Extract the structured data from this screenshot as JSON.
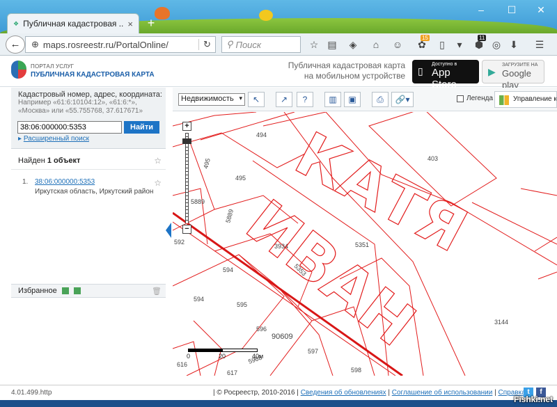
{
  "browser": {
    "tab_title": "Публичная кадастровая ...",
    "tab_close": "×",
    "new_tab": "+",
    "url": "maps.rosreestr.ru/PortalOnline/",
    "search_placeholder": "Поиск",
    "min": "–",
    "max": "☐",
    "close": "✕",
    "badge_15": "15",
    "badge_11": "11"
  },
  "portal": {
    "subtitle": "ПОРТАЛ УСЛУГ",
    "title": "ПУБЛИЧНАЯ КАДАСТРОВАЯ КАРТА",
    "mobile_line1": "Публичная кадастровая карта",
    "mobile_line2": "на мобильном устройстве",
    "appstore_small": "Доступно в",
    "appstore_big": "App Store",
    "google_small": "ЗАГРУЗИТЕ НА",
    "google_big": "Google play"
  },
  "search": {
    "hint_title": "Кадастровый номер, адрес, координата:",
    "hint_line1": "Например «61:6:10104:12», «61:6:*»,",
    "hint_line2": "«Москва» или «55.755768, 37.617671»",
    "value": "38:06:000000:5353",
    "button": "Найти",
    "advanced": "Расширенный поиск"
  },
  "results": {
    "found_prefix": "Найден ",
    "found_count": "1 объект",
    "items": [
      {
        "num": "1.",
        "id": "38:06:000000:5353",
        "address": "Иркутская область, Иркутский район"
      }
    ]
  },
  "favorites": {
    "label": "Избранное"
  },
  "toolbar": {
    "layer": "Недвижимость",
    "legend": "Легенда",
    "manage": "Управление к"
  },
  "map": {
    "parcels": [
      "494",
      "403",
      "495",
      "495",
      "5889",
      "5889",
      "592",
      "3934",
      "5351",
      "594",
      "5353",
      "594",
      "595",
      "596",
      "90609",
      "597",
      "3144",
      "598",
      "616",
      "617",
      "5968"
    ],
    "big_text": [
      "КАТЯ",
      "ИВАН"
    ],
    "scale_labels": [
      "0",
      "20",
      "40м"
    ]
  },
  "footer": {
    "version": "4.01.499.http",
    "copyright": "| © Росреестр, 2010-2016 |",
    "link1": "Сведения об обновлениях",
    "sep": "|",
    "link2": "Соглашение об использовании",
    "link3": "Справка",
    "watermark": "Fishki.net"
  }
}
